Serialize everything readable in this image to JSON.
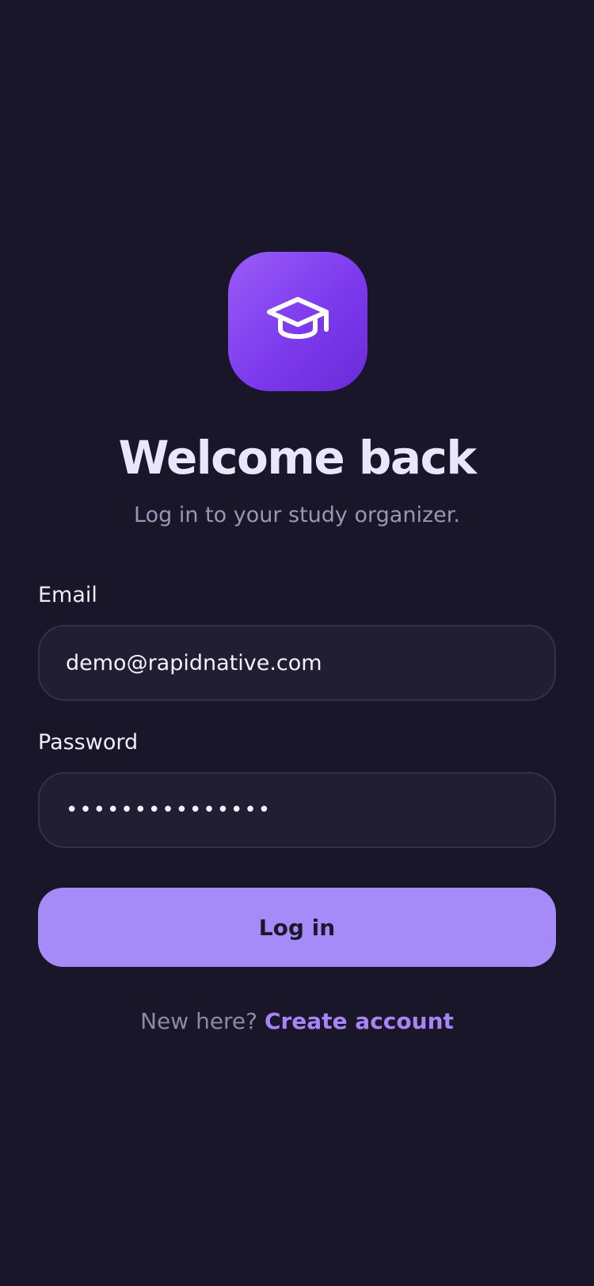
{
  "colors": {
    "background": "#19162a",
    "accent": "#a58bf8",
    "brand_gradient_start": "#9a5cf7",
    "brand_gradient_end": "#6a2bd9",
    "link": "#a784f8"
  },
  "logo": {
    "icon": "graduation-cap-icon"
  },
  "header": {
    "title": "Welcome back",
    "subtitle": "Log in to your study organizer."
  },
  "form": {
    "email_label": "Email",
    "email_value": "demo@rapidnative.com",
    "password_label": "Password",
    "password_value": "•••••••••••••••"
  },
  "actions": {
    "login_label": "Log in"
  },
  "footer": {
    "prefix": "New here?",
    "link_label": "Create account"
  }
}
